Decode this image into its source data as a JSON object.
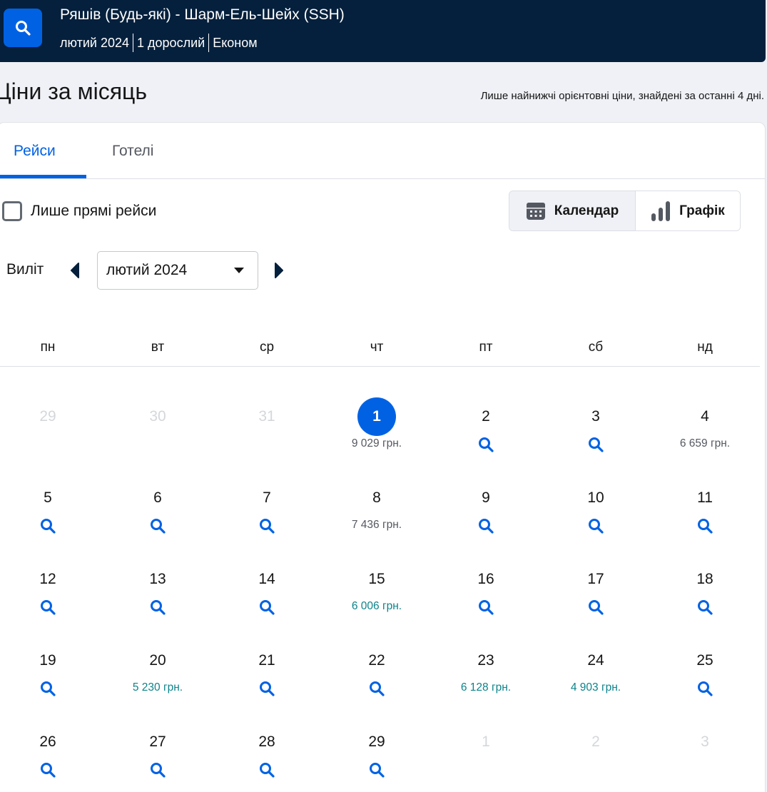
{
  "header": {
    "route": "Ряшів (Будь-які) - Шарм-Ель-Шейх (SSH)",
    "month": "лютий 2024",
    "travellers": "1 дорослий",
    "cabin": "Економ"
  },
  "page": {
    "title": "Ціни за місяць",
    "disclaimer": "Лише найнижчі орієнтовні ціни, знайдені за останні 4 дні."
  },
  "tabs": [
    {
      "label": "Рейси",
      "active": true
    },
    {
      "label": "Готелі",
      "active": false
    }
  ],
  "filters": {
    "direct_only_label": "Лише прямі рейси",
    "direct_only_checked": false
  },
  "view_toggle": {
    "calendar_label": "Календар",
    "graph_label": "Графік",
    "active": "calendar"
  },
  "departure": {
    "label": "Виліт",
    "selected_month": "лютий 2024"
  },
  "weekdays": [
    "пн",
    "вт",
    "ср",
    "чт",
    "пт",
    "сб",
    "нд"
  ],
  "calendar": [
    [
      {
        "day": "29",
        "muted": true
      },
      {
        "day": "30",
        "muted": true
      },
      {
        "day": "31",
        "muted": true
      },
      {
        "day": "1",
        "selected": true,
        "price": "9 029 грн."
      },
      {
        "day": "2",
        "search": true
      },
      {
        "day": "3",
        "search": true
      },
      {
        "day": "4",
        "price": "6 659 грн."
      }
    ],
    [
      {
        "day": "5",
        "search": true
      },
      {
        "day": "6",
        "search": true
      },
      {
        "day": "7",
        "search": true
      },
      {
        "day": "8",
        "price": "7 436 грн."
      },
      {
        "day": "9",
        "search": true
      },
      {
        "day": "10",
        "search": true
      },
      {
        "day": "11",
        "search": true
      }
    ],
    [
      {
        "day": "12",
        "search": true
      },
      {
        "day": "13",
        "search": true
      },
      {
        "day": "14",
        "search": true
      },
      {
        "day": "15",
        "price": "6 006 грн.",
        "cheap": true
      },
      {
        "day": "16",
        "search": true
      },
      {
        "day": "17",
        "search": true
      },
      {
        "day": "18",
        "search": true
      }
    ],
    [
      {
        "day": "19",
        "search": true
      },
      {
        "day": "20",
        "price": "5 230 грн.",
        "cheap": true
      },
      {
        "day": "21",
        "search": true
      },
      {
        "day": "22",
        "search": true
      },
      {
        "day": "23",
        "price": "6 128 грн.",
        "cheap": true
      },
      {
        "day": "24",
        "price": "4 903 грн.",
        "cheap": true
      },
      {
        "day": "25",
        "search": true
      }
    ],
    [
      {
        "day": "26",
        "search": true
      },
      {
        "day": "27",
        "search": true
      },
      {
        "day": "28",
        "search": true
      },
      {
        "day": "29",
        "search": true
      },
      {
        "day": "1",
        "muted": true
      },
      {
        "day": "2",
        "muted": true
      },
      {
        "day": "3",
        "muted": true
      }
    ]
  ],
  "colors": {
    "brand_dark": "#05203c",
    "accent": "#0062e3",
    "cheap_price": "#0c838a",
    "muted_day": "#d4d7db"
  },
  "icons": {
    "search_button": "search-icon",
    "calendar_view": "calendar-icon",
    "graph_view": "bar-chart-icon",
    "prev_month": "caret-left-icon",
    "next_month": "caret-right-icon",
    "month_dropdown": "caret-down-icon",
    "day_search": "search-icon"
  }
}
